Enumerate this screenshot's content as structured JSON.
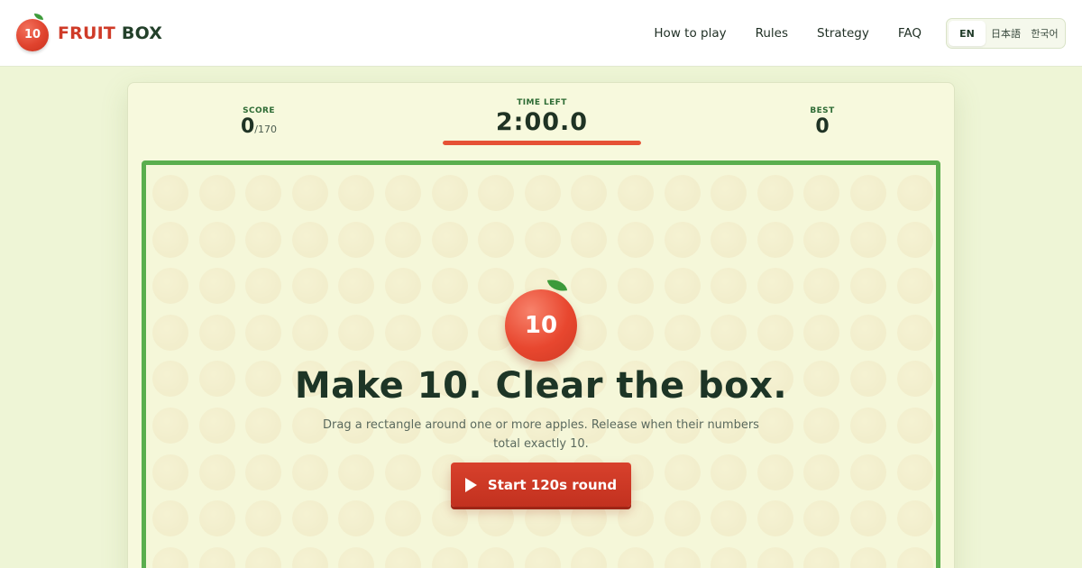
{
  "header": {
    "brand": {
      "logo_number": "10",
      "word1": "FRUIT",
      "word2": "BOX"
    },
    "nav": [
      {
        "label": "How to play"
      },
      {
        "label": "Rules"
      },
      {
        "label": "Strategy"
      },
      {
        "label": "FAQ"
      }
    ],
    "languages": [
      {
        "label": "EN",
        "active": true
      },
      {
        "label": "日本語",
        "active": false
      },
      {
        "label": "한국어",
        "active": false
      }
    ]
  },
  "stats": {
    "score": {
      "label": "SCORE",
      "value": "0",
      "total": "/170"
    },
    "time": {
      "label": "TIME LEFT",
      "value": "2:00.0",
      "remaining_fraction": 1.0
    },
    "best": {
      "label": "BEST",
      "value": "0"
    }
  },
  "board": {
    "hero_number": "10",
    "headline": "Make 10. Clear the box.",
    "instructions": "Drag a rectangle around one or more apples. Release when their numbers total exactly 10.",
    "start_label": "Start 120s round"
  },
  "colors": {
    "accent_red": "#d8412c",
    "board_border": "#5aae4e",
    "timer_bar": "#e65235",
    "background": "#eef5d6"
  },
  "icons": [
    "apple-logo-icon",
    "play-icon",
    "leaf-icon"
  ]
}
